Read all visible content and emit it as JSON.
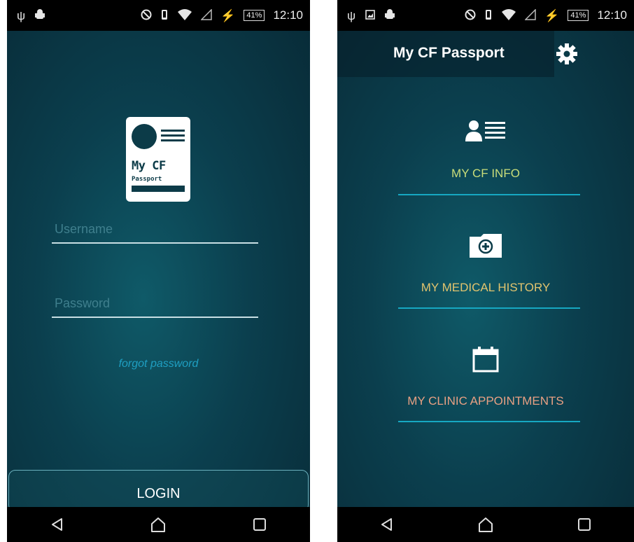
{
  "status_bar": {
    "battery_percent": "41%",
    "time": "12:10",
    "icons": [
      "usb-icon",
      "android-debug-icon",
      "do-not-disturb-icon",
      "vibrate-icon",
      "wifi-icon",
      "signal-icon",
      "charging-icon",
      "battery-icon"
    ]
  },
  "login_screen": {
    "logo_title": "My CF",
    "logo_subtitle": "Passport",
    "username_placeholder": "Username",
    "password_placeholder": "Password",
    "forgot_password": "forgot password",
    "login_button": "LOGIN"
  },
  "home_screen": {
    "title": "My CF Passport",
    "menu": [
      {
        "label": "MY CF INFO",
        "icon": "profile-card-icon",
        "color": "#c9dd7a"
      },
      {
        "label": "MY MEDICAL HISTORY",
        "icon": "medical-folder-icon",
        "color": "#e2c46e"
      },
      {
        "label": "MY CLINIC APPOINTMENTS",
        "icon": "calendar-icon",
        "color": "#e8a083"
      }
    ],
    "divider_color": "#16a8c2"
  },
  "nav_bar": {
    "buttons": [
      "back-icon",
      "home-icon",
      "recents-icon"
    ]
  }
}
